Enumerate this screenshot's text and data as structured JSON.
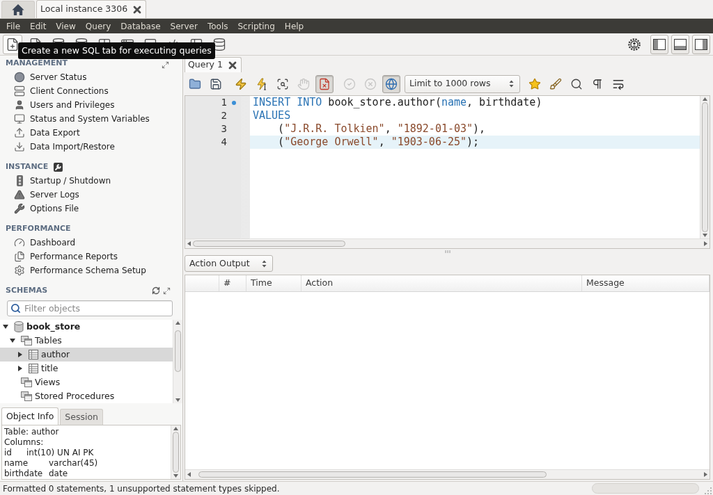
{
  "window_tabs": [
    {
      "kind": "home",
      "selected": false
    },
    {
      "kind": "connection",
      "label": "Local instance 3306",
      "selected": true
    }
  ],
  "menu": [
    "File",
    "Edit",
    "View",
    "Query",
    "Database",
    "Server",
    "Tools",
    "Scripting",
    "Help"
  ],
  "main_toolbar": {
    "buttons": [
      {
        "hovered": true
      },
      {
        "hovered": false
      },
      {
        "hovered": false
      },
      {
        "hovered": false
      },
      {
        "hovered": false
      },
      {
        "hovered": false
      },
      {
        "hovered": false
      },
      {
        "hovered": false
      },
      {
        "hovered": false
      },
      {
        "hovered": false
      }
    ],
    "tooltip": "Create a new SQL tab for executing queries"
  },
  "sidebar": {
    "sections": [
      {
        "title": "MANAGEMENT",
        "items": [
          "Server Status",
          "Client Connections",
          "Users and Privileges",
          "Status and System Variables",
          "Data Export",
          "Data Import/Restore"
        ]
      },
      {
        "title": "INSTANCE",
        "items": [
          "Startup / Shutdown",
          "Server Logs",
          "Options File"
        ]
      },
      {
        "title": "PERFORMANCE",
        "items": [
          "Dashboard",
          "Performance Reports",
          "Performance Schema Setup"
        ]
      }
    ],
    "schemas": {
      "title": "SCHEMAS",
      "filter": {
        "placeholder": "Filter objects"
      },
      "tree": [
        {
          "kind": "schema",
          "label": "book_store",
          "default": true,
          "expanded": true,
          "selected": false,
          "children": [
            {
              "kind": "group",
              "label": "Tables",
              "expanded": true,
              "selected": false,
              "children": [
                {
                  "kind": "table",
                  "label": "author",
                  "expanded": false,
                  "selected": true
                },
                {
                  "kind": "table",
                  "label": "title",
                  "expanded": false,
                  "selected": false
                }
              ]
            },
            {
              "kind": "group",
              "label": "Views",
              "selected": false
            },
            {
              "kind": "group",
              "label": "Stored Procedures",
              "selected": false
            }
          ]
        }
      ]
    },
    "info_tabs": [
      {
        "label": "Object Info",
        "selected": true
      },
      {
        "label": "Session",
        "selected": false
      }
    ],
    "object_info": [
      "Table: author",
      "Columns:",
      "id\tint(10) UN AI PK",
      "name\tvarchar(45)",
      "birthdate\tdate"
    ]
  },
  "query_tabs": [
    {
      "label": "Query 1",
      "selected": true
    }
  ],
  "query_toolbar": [
    {
      "kind": "button",
      "disabled": false,
      "on": false
    },
    {
      "kind": "button",
      "disabled": false,
      "on": false
    },
    {
      "kind": "button",
      "disabled": false,
      "on": false
    },
    {
      "kind": "button",
      "disabled": false,
      "on": false
    },
    {
      "kind": "button",
      "disabled": false,
      "on": false
    },
    {
      "kind": "button",
      "disabled": true,
      "on": false
    },
    {
      "kind": "button",
      "disabled": false,
      "on": true
    },
    {
      "kind": "button",
      "disabled": true,
      "on": false
    },
    {
      "kind": "button",
      "disabled": true,
      "on": false
    },
    {
      "kind": "button",
      "disabled": false,
      "on": true
    },
    {
      "kind": "select",
      "value": "Limit to 1000 rows"
    },
    {
      "kind": "button",
      "disabled": false,
      "on": false
    },
    {
      "kind": "button",
      "disabled": false,
      "on": false
    },
    {
      "kind": "button",
      "disabled": false,
      "on": false
    },
    {
      "kind": "button",
      "disabled": false,
      "on": false
    },
    {
      "kind": "button",
      "disabled": false,
      "on": false
    }
  ],
  "editor": {
    "lines": [
      {
        "number": "1",
        "marker": true,
        "current": false,
        "tokens": [
          {
            "text": "INSERT INTO",
            "kind": "keyword"
          },
          {
            "text": " book_store.author(",
            "kind": "plain"
          },
          {
            "text": "name",
            "kind": "keyword"
          },
          {
            "text": ", birthdate)",
            "kind": "plain"
          }
        ]
      },
      {
        "number": "2",
        "marker": false,
        "current": false,
        "tokens": [
          {
            "text": "VALUES",
            "kind": "keyword"
          }
        ]
      },
      {
        "number": "3",
        "marker": false,
        "current": false,
        "tokens": [
          {
            "text": "    (",
            "kind": "plain"
          },
          {
            "text": "\"J.R.R. Tolkien\"",
            "kind": "string"
          },
          {
            "text": ", ",
            "kind": "plain"
          },
          {
            "text": "\"1892-01-03\"",
            "kind": "string"
          },
          {
            "text": "),",
            "kind": "plain"
          }
        ]
      },
      {
        "number": "4",
        "marker": false,
        "current": true,
        "tokens": [
          {
            "text": "    (",
            "kind": "plain"
          },
          {
            "text": "\"George Orwell\"",
            "kind": "string"
          },
          {
            "text": ", ",
            "kind": "plain"
          },
          {
            "text": "\"1903-06-25\"",
            "kind": "string"
          },
          {
            "text": ");",
            "kind": "plain"
          }
        ]
      }
    ]
  },
  "output": {
    "view": "Action Output",
    "columns": [
      "#",
      "Time",
      "Action",
      "Message"
    ]
  },
  "status_bar": {
    "message": "Formatted 0 statements, 1 unsupported statement types skipped."
  }
}
